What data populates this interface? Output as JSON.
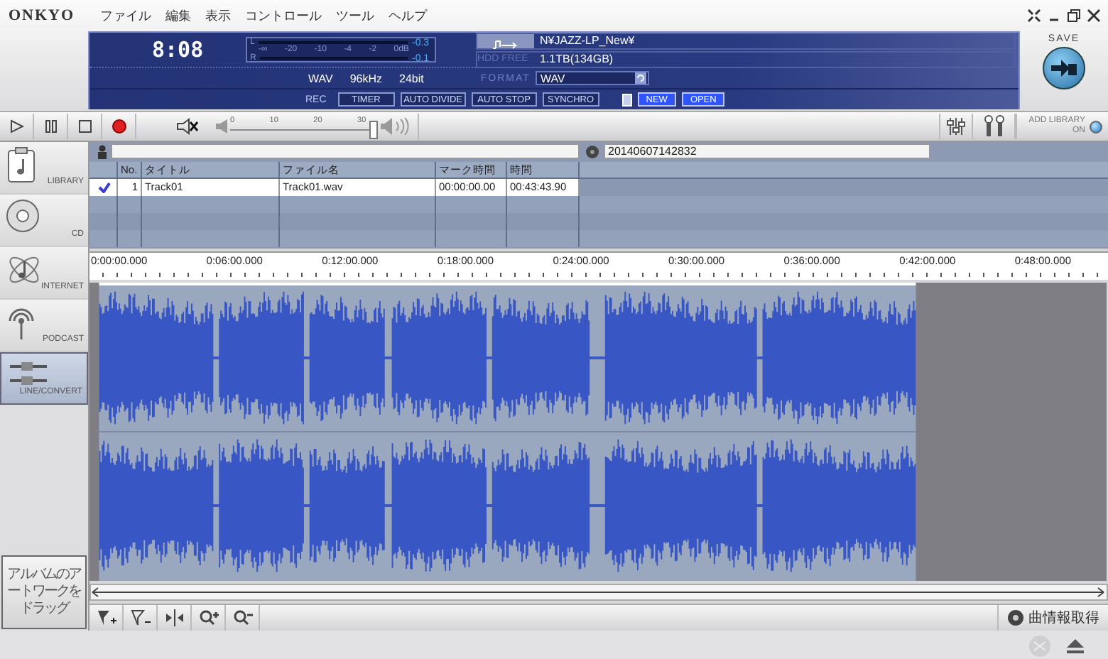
{
  "menu_bar": {
    "logo": "ONKYO",
    "items": [
      "ファイル",
      "編集",
      "表示",
      "コントロール",
      "ツール",
      "ヘルプ"
    ]
  },
  "display": {
    "time": "8:08",
    "meter": {
      "scale": [
        "-∞",
        "-20",
        "-10",
        "-4",
        "-2",
        "0dB"
      ],
      "channels": [
        {
          "label": "L",
          "peak": "-0.3"
        },
        {
          "label": "R",
          "peak": "-0.1"
        }
      ]
    },
    "destination": {
      "path": "N¥JAZZ-LP_New¥",
      "free_label": "HDD FREE",
      "free": "1.1TB(134GB)"
    },
    "audio_info": [
      "WAV",
      "96kHz",
      "24bit"
    ],
    "format": {
      "label": "FORMAT",
      "value": "WAV"
    },
    "rec": {
      "label": "REC",
      "buttons": [
        "TIMER",
        "AUTO DIVIDE",
        "AUTO STOP",
        "SYNCHRO"
      ]
    },
    "file_buttons": [
      "NEW",
      "OPEN"
    ]
  },
  "save": {
    "label": "SAVE"
  },
  "transport": {
    "volume": {
      "ticks": [
        "0",
        "10",
        "20",
        "30"
      ],
      "level": 0.97
    },
    "add_library": {
      "label": "ADD LIBRARY",
      "state": "ON",
      "on": true
    }
  },
  "sidebar": {
    "items": [
      {
        "kind": "library",
        "label": "LIBRARY",
        "selected": false
      },
      {
        "kind": "cd",
        "label": "CD",
        "selected": false
      },
      {
        "kind": "internet",
        "label": "INTERNET",
        "selected": false
      },
      {
        "kind": "podcast",
        "label": "PODCAST",
        "selected": false
      },
      {
        "kind": "line",
        "label": "LINE/CONVERT",
        "selected": true
      }
    ],
    "artwork_drop": "アルバムのアートワークをドラッグ"
  },
  "album": {
    "title": "20140607142832"
  },
  "table": {
    "columns": [
      "No.",
      "タイトル",
      "ファイル名",
      "マーク時間",
      "時間"
    ],
    "rows": [
      {
        "checked": true,
        "no": "1",
        "title": "Track01",
        "file": "Track01.wav",
        "mark": "00:00:00.00",
        "time": "00:43:43.90"
      }
    ]
  },
  "timeline": {
    "ticks": [
      "0:00:00.000",
      "0:06:00.000",
      "0:12:00.000",
      "0:18:00.000",
      "0:24:00.000",
      "0:30:00.000",
      "0:36:00.000",
      "0:42:00.000",
      "0:48:00.000"
    ]
  },
  "tools": {
    "get_info": "曲情報取得"
  }
}
